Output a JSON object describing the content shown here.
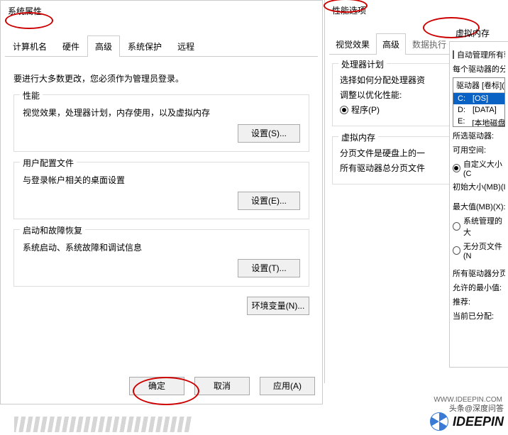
{
  "left": {
    "title": "系统属性",
    "tabs": [
      "计算机名",
      "硬件",
      "高级",
      "系统保护",
      "远程"
    ],
    "active_tab": 2,
    "admin_note": "要进行大多数更改，您必须作为管理员登录。",
    "perf": {
      "title": "性能",
      "desc": "视觉效果，处理器计划，内存使用，以及虚拟内存",
      "btn": "设置(S)..."
    },
    "profile": {
      "title": "用户配置文件",
      "desc": "与登录帐户相关的桌面设置",
      "btn": "设置(E)..."
    },
    "startup": {
      "title": "启动和故障恢复",
      "desc": "系统启动、系统故障和调试信息",
      "btn": "设置(T)..."
    },
    "env_btn": "环境变量(N)...",
    "ok": "确定",
    "cancel": "取消",
    "apply": "应用(A)"
  },
  "right": {
    "title": "性能选项",
    "tabs": [
      "视觉效果",
      "高级",
      "数据执行",
      "虚拟内存"
    ],
    "active_tab": 1,
    "proc": {
      "title": "处理器计划",
      "desc": "选择如何分配处理器资",
      "adjust": "调整以优化性能:",
      "opt_program": "程序(P)"
    },
    "vm": {
      "title": "虚拟内存",
      "desc": "分页文件是硬盘上的一",
      "total": "所有驱动器总分页文件"
    }
  },
  "vmem": {
    "auto": "自动管理所有驱",
    "per_drive": "每个驱动器的分页",
    "drive_header": "驱动器 [卷标](D",
    "drives": [
      {
        "letter": "C:",
        "label": "[OS]"
      },
      {
        "letter": "D:",
        "label": "[DATA]"
      },
      {
        "letter": "E:",
        "label": "[本地磁盘"
      }
    ],
    "selected_drive": "所选驱动器:",
    "avail": "可用空间:",
    "custom": "自定义大小(C",
    "initial": "初始大小(MB)(I)",
    "max": "最大值(MB)(X):",
    "sys": "系统管理的大",
    "none": "无分页文件(N",
    "all_drives": "所有驱动器分页文",
    "min": "允许的最小值:",
    "rec": "推荐:",
    "cur": "当前已分配:"
  },
  "wm": {
    "attr": "头条@深度问答",
    "url": "WWW.IDEEPIN.COM",
    "brand": "IDEEPIN"
  }
}
